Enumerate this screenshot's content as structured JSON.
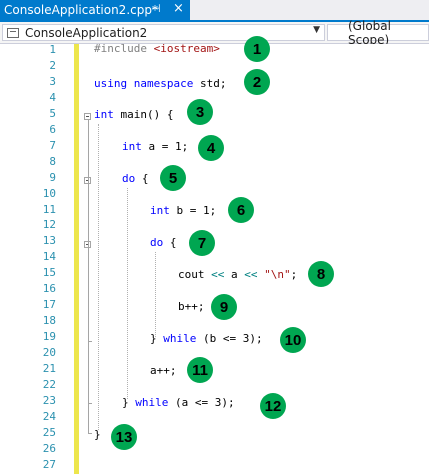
{
  "tab": {
    "title": "ConsoleApplication2.cpp*",
    "pin_glyph": "⊣",
    "close_glyph": "×"
  },
  "navbar": {
    "project": "ConsoleApplication2",
    "scope": "(Global Scope)"
  },
  "line_numbers": [
    "1",
    "2",
    "3",
    "4",
    "5",
    "6",
    "7",
    "8",
    "9",
    "10",
    "11",
    "12",
    "13",
    "14",
    "15",
    "16",
    "17",
    "18",
    "19",
    "20",
    "21",
    "22",
    "23",
    "24",
    "25",
    "26",
    "27"
  ],
  "code": {
    "l1": {
      "pp": "#include ",
      "str": "<iostream>"
    },
    "l3": {
      "kw1": "using",
      "kw2": "namespace",
      "rest": " std;"
    },
    "l5": {
      "kw": "int",
      "rest": " main() {"
    },
    "l7": {
      "kw": "int",
      "rest": " a = 1;"
    },
    "l9": {
      "kw": "do",
      "rest": " {"
    },
    "l11": {
      "kw": "int",
      "rest": " b = 1;"
    },
    "l13": {
      "kw": "do",
      "rest": " {"
    },
    "l15": {
      "a": "cout ",
      "op1": "<<",
      "b": " a ",
      "op2": "<<",
      "c": " ",
      "str": "\"\\n\"",
      "d": ";"
    },
    "l17": {
      "text": "b++;"
    },
    "l19": {
      "a": "} ",
      "kw": "while",
      "rest": " (b <= 3);"
    },
    "l21": {
      "text": "a++;"
    },
    "l23": {
      "a": "} ",
      "kw": "while",
      "rest": " (a <= 3);"
    },
    "l25": {
      "text": "}"
    }
  },
  "badges": [
    "1",
    "2",
    "3",
    "4",
    "5",
    "6",
    "7",
    "8",
    "9",
    "10",
    "11",
    "12",
    "13"
  ],
  "colors": {
    "accent": "#007acc",
    "keyword": "#0000ff",
    "string": "#a31515",
    "operator": "#008080",
    "line_number": "#2b91af",
    "change_bar": "#ede64c",
    "badge": "#00a651"
  }
}
